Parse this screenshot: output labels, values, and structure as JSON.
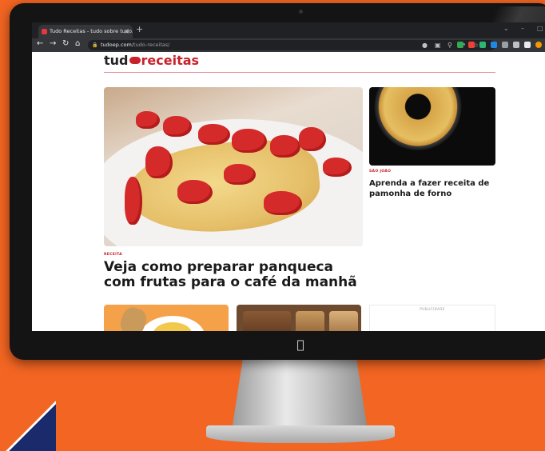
{
  "browser": {
    "tab_title": "Tudo Receitas - tudo sobre tudo.",
    "tab_close": "×",
    "new_tab": "+",
    "url_host": "tudoep.com",
    "url_path": "/tudo-receitas/"
  },
  "site": {
    "logo_tud": "tud",
    "logo_receitas": "receitas"
  },
  "hero": {
    "kicker": "RECEITA",
    "title": "Veja como preparar panqueca com frutas para o café da manhã"
  },
  "side_story": {
    "kicker": "SÃO JOÃO",
    "title": "Aprenda a fazer receita de pamonha de forno"
  },
  "ad": {
    "label": "PUBLICIDADE"
  },
  "colors": {
    "background_orange": "#f26522",
    "brand_red": "#c8212b",
    "browser_dark": "#202124"
  }
}
